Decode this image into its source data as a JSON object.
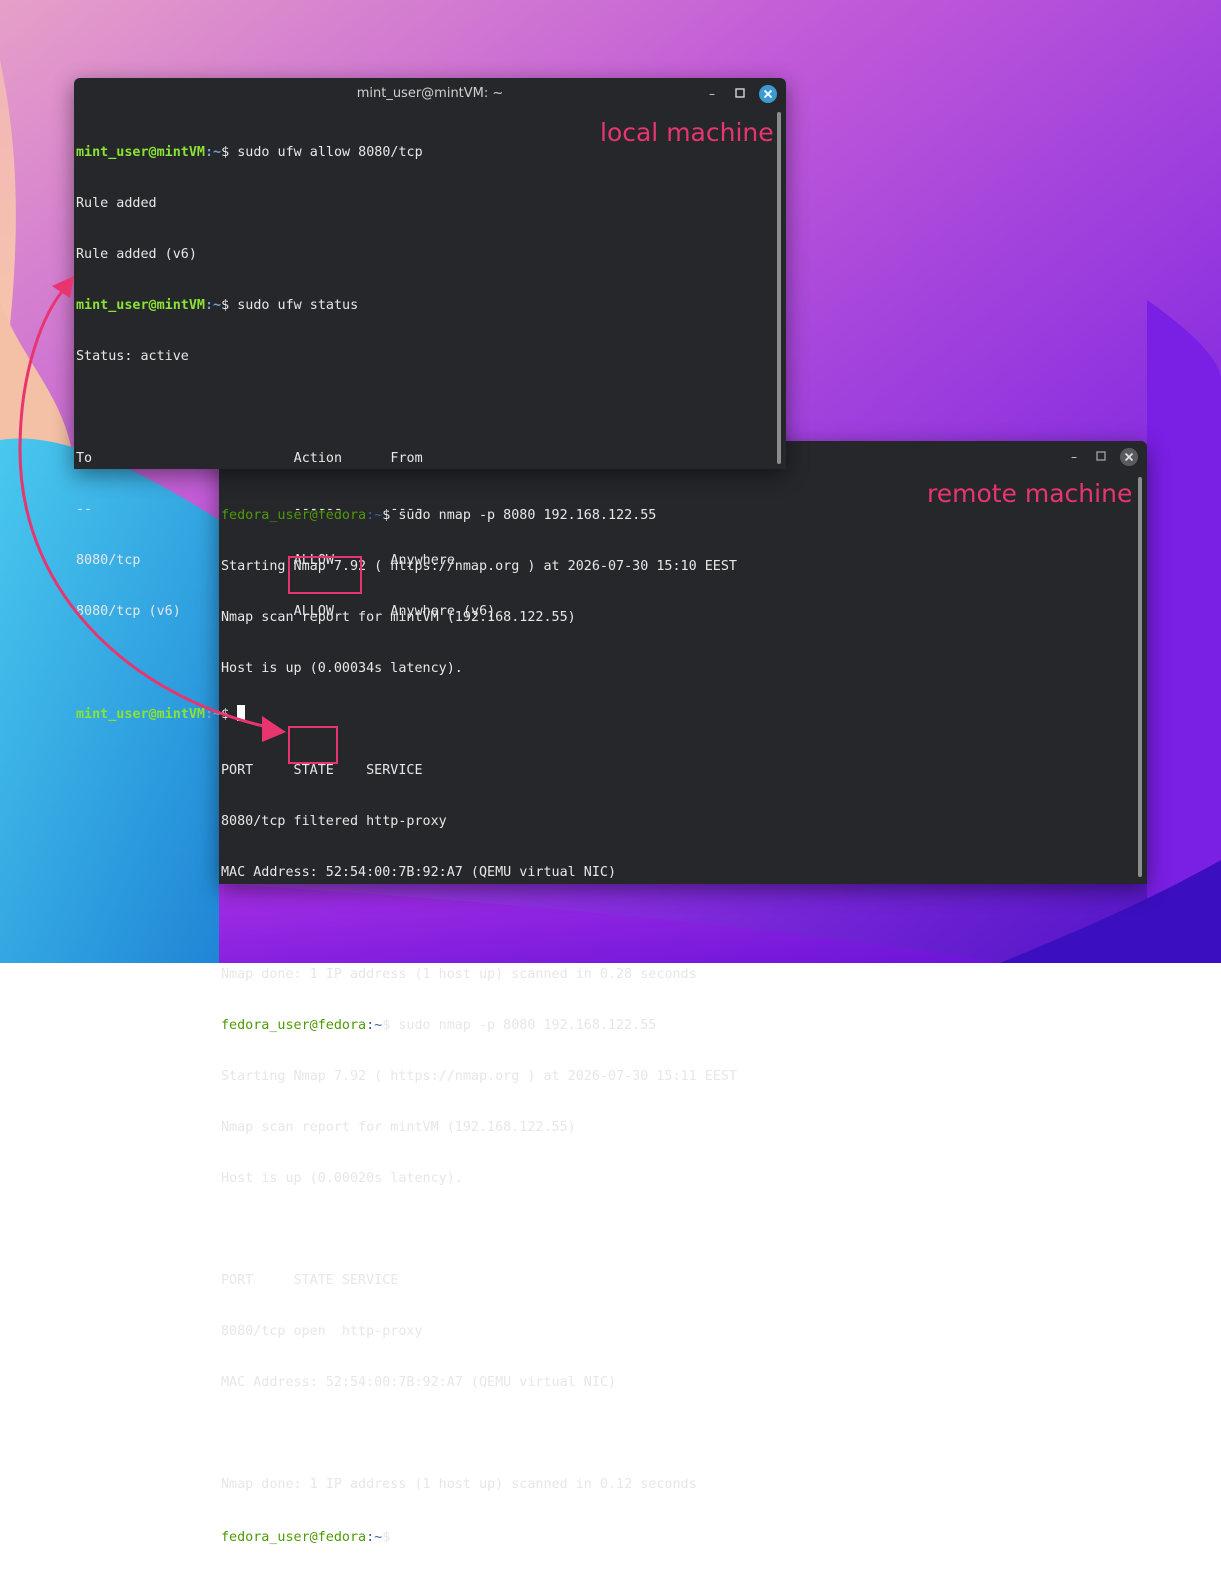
{
  "colors": {
    "accent": "#e8356f",
    "terminal_bg": "#26272b",
    "close_button": "#3d9ad1"
  },
  "local_window": {
    "title": "mint_user@mintVM: ~",
    "annotation": "local machine",
    "prompt_user": "mint_user@mintVM",
    "prompt_path": ":~",
    "prompt_dollar": "$ ",
    "cmd1": "sudo ufw allow 8080/tcp",
    "out1": "Rule added",
    "out2": "Rule added (v6)",
    "cmd2": "sudo ufw status",
    "status": "Status: active",
    "table_header": "To                         Action      From",
    "table_rule": "--                         ------      ----",
    "table_rows": [
      "8080/tcp                   ALLOW       Anywhere",
      "8080/tcp (v6)              ALLOW       Anywhere (v6)"
    ]
  },
  "remote_window": {
    "annotation": "remote machine",
    "prompt_user": "fedora_user@fedora",
    "prompt_path": ":~",
    "prompt_dollar": "$ ",
    "scan1": {
      "cmd": "sudo nmap -p 8080 192.168.122.55",
      "starting": "Starting Nmap 7.92 ( https://nmap.org ) at 2026-07-30 15:10 EEST",
      "report": "Nmap scan report for mintVM (192.168.122.55)",
      "host_up": "Host is up (0.00034s latency).",
      "header": "PORT     STATE    SERVICE",
      "row": "8080/tcp filtered http-proxy",
      "mac": "MAC Address: 52:54:00:7B:92:A7 (QEMU virtual NIC)",
      "done": "Nmap done: 1 IP address (1 host up) scanned in 0.28 seconds"
    },
    "scan2": {
      "cmd": "sudo nmap -p 8080 192.168.122.55",
      "starting": "Starting Nmap 7.92 ( https://nmap.org ) at 2026-07-30 15:11 EEST",
      "report": "Nmap scan report for mintVM (192.168.122.55)",
      "host_up": "Host is up (0.00020s latency).",
      "header": "PORT     STATE SERVICE",
      "row": "8080/tcp open  http-proxy",
      "mac": "MAC Address: 52:54:00:7B:92:A7 (QEMU virtual NIC)",
      "done": "Nmap done: 1 IP address (1 host up) scanned in 0.12 seconds"
    }
  }
}
